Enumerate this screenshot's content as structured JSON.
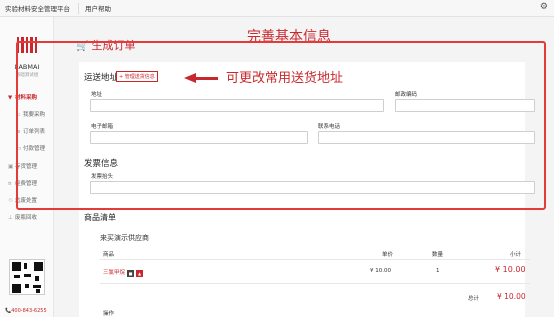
{
  "topbar": {
    "brand": "实验材料安全管理平台",
    "help": "用户帮助",
    "settings_icon": "gear-icon"
  },
  "sidebar": {
    "org_name": "LABMAI",
    "org_sub": "基础测试组",
    "nav": [
      {
        "label": "材料采购",
        "icon": "cart-icon",
        "active": true
      },
      {
        "label": "我要采购",
        "icon": "cart-icon"
      },
      {
        "label": "订单列表",
        "icon": "list-icon"
      },
      {
        "label": "付款管理",
        "icon": "card-icon"
      },
      {
        "label": "存货管理",
        "icon": "box-icon"
      },
      {
        "label": "经费管理",
        "icon": "money-icon"
      },
      {
        "label": "危废处置",
        "icon": "recycle-icon"
      },
      {
        "label": "废瓶回收",
        "icon": "flask-icon"
      }
    ],
    "phone": "400-843-6255"
  },
  "main": {
    "page_title": "生成订单",
    "annotation_title": "完善基本信息",
    "annotation_side": "可更改常用送货地址",
    "shipping": {
      "title": "运送地址",
      "manage_link": "+ 管理送货信息",
      "address_label": "地址",
      "zip_label": "邮政编码",
      "email_label": "电子邮箱",
      "contact_label": "联系电话",
      "address_value": "",
      "zip_value": "",
      "email_value": "",
      "contact_value": ""
    },
    "invoice": {
      "title": "发票信息",
      "header_label": "发票抬头",
      "header_value": ""
    },
    "goods": {
      "title": "商品清单",
      "supplier": "来买演示供应商",
      "columns": [
        "商品",
        "单价",
        "数量",
        "小计"
      ],
      "rows": [
        {
          "name": "三氯甲烷",
          "unit_price": "¥ 10.00",
          "qty": "1",
          "subtotal": "¥ 10.00"
        }
      ],
      "total_label": "总计",
      "total_value": "¥ 10.00",
      "op_label": "操作"
    }
  },
  "colors": {
    "accent": "#c8282d",
    "annotation_red": "#e53a3a"
  }
}
